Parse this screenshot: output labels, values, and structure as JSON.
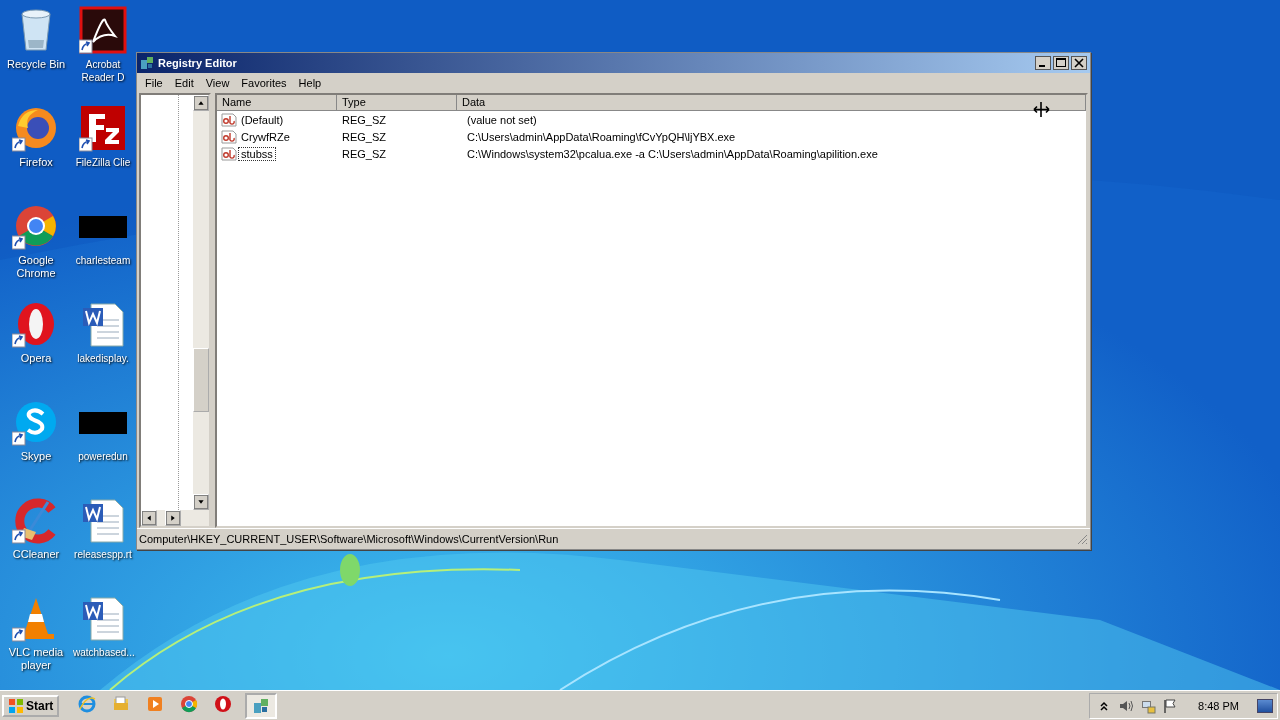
{
  "desktop_icons": [
    {
      "label": "Recycle Bin",
      "kind": "recycle"
    },
    {
      "label": "Acrobat Reader D",
      "kind": "acrobat"
    },
    {
      "label": "Firefox",
      "kind": "firefox"
    },
    {
      "label": "FileZilla Clie",
      "kind": "filezilla"
    },
    {
      "label": "Google Chrome",
      "kind": "chrome"
    },
    {
      "label": "charlesteam",
      "kind": "blank"
    },
    {
      "label": "Opera",
      "kind": "opera"
    },
    {
      "label": "lakedisplay.",
      "kind": "word"
    },
    {
      "label": "Skype",
      "kind": "skype"
    },
    {
      "label": "poweredun",
      "kind": "blank"
    },
    {
      "label": "CCleaner",
      "kind": "ccleaner"
    },
    {
      "label": "releasespp.rt",
      "kind": "word"
    },
    {
      "label": "VLC media player",
      "kind": "vlc"
    },
    {
      "label": "watchbased...",
      "kind": "word"
    }
  ],
  "window": {
    "title": "Registry Editor",
    "menu": [
      "File",
      "Edit",
      "View",
      "Favorites",
      "Help"
    ],
    "columns": [
      "Name",
      "Type",
      "Data"
    ],
    "rows": [
      {
        "name": "(Default)",
        "type": "REG_SZ",
        "data": "(value not set)",
        "selected": false
      },
      {
        "name": "CrywfRZe",
        "type": "REG_SZ",
        "data": "C:\\Users\\admin\\AppData\\Roaming\\fCvYpQH\\ljYBX.exe",
        "selected": false
      },
      {
        "name": "stubss",
        "type": "REG_SZ",
        "data": "C:\\Windows\\system32\\pcalua.exe -a C:\\Users\\admin\\AppData\\Roaming\\apilition.exe",
        "selected": true
      }
    ],
    "status_bar": "Computer\\HKEY_CURRENT_USER\\Software\\Microsoft\\Windows\\CurrentVersion\\Run"
  },
  "taskbar": {
    "start": "Start",
    "apps": [
      {
        "kind": "ie",
        "selected": false
      },
      {
        "kind": "folder",
        "selected": false
      },
      {
        "kind": "media",
        "selected": false
      },
      {
        "kind": "chrome",
        "selected": false
      },
      {
        "kind": "opera",
        "selected": false
      },
      {
        "kind": "regedit",
        "selected": true
      }
    ],
    "clock": "8:48 PM"
  }
}
